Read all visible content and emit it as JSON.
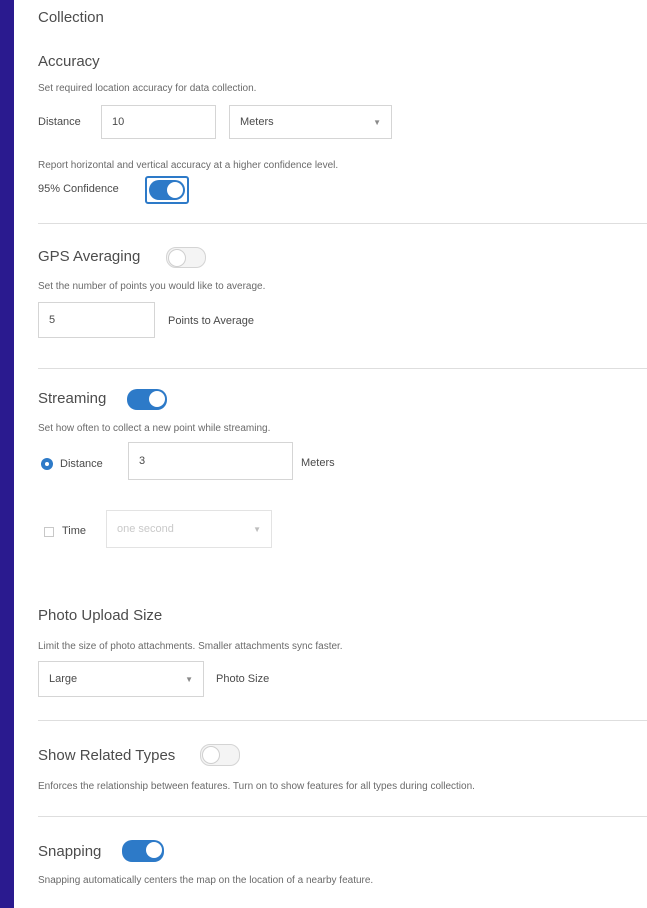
{
  "colors": {
    "accent": "#2d7ac8",
    "frame": "#2a1a8f"
  },
  "page_title": "Collection",
  "accuracy": {
    "heading": "Accuracy",
    "description": "Set required location accuracy for data collection.",
    "distance_label": "Distance",
    "distance_value": "10",
    "unit": "Meters",
    "report_text": "Report horizontal and vertical accuracy at a higher confidence level.",
    "confidence_label": "95% Confidence",
    "confidence_on": true
  },
  "gps_averaging": {
    "heading": "GPS Averaging",
    "enabled": false,
    "description": "Set the number of points you would like to average.",
    "points_value": "5",
    "points_label": "Points to Average"
  },
  "streaming": {
    "heading": "Streaming",
    "enabled": true,
    "description": "Set how often to collect a new point while streaming.",
    "distance_label": "Distance",
    "distance_value": "3",
    "distance_unit": "Meters",
    "time_label": "Time",
    "time_value": "one second"
  },
  "photo": {
    "heading": "Photo Upload Size",
    "description": "Limit the size of photo attachments. Smaller attachments sync faster.",
    "size_value": "Large",
    "size_label": "Photo Size"
  },
  "related_types": {
    "heading": "Show Related Types",
    "enabled": false,
    "description": "Enforces the relationship between features. Turn on to show features for all types during collection."
  },
  "snapping": {
    "heading": "Snapping",
    "enabled": true,
    "description": "Snapping automatically centers the map on the location of a nearby feature."
  }
}
